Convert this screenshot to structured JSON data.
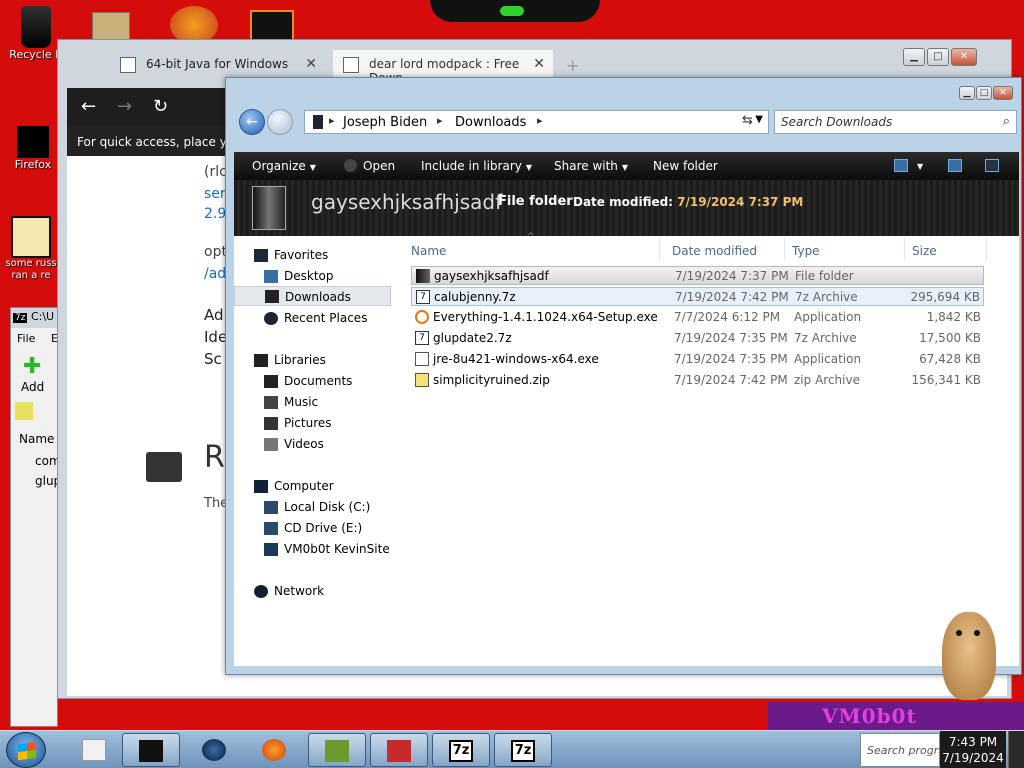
{
  "desktop": {
    "icons": [
      {
        "name": "recycle-bin",
        "label": "Recycle B"
      },
      {
        "name": "firefox",
        "label": "Firefox"
      },
      {
        "name": "russian",
        "label": "some russ ran a re"
      }
    ],
    "taskbar_logo_text": "VM0b0t"
  },
  "browser": {
    "tabs": [
      {
        "label": "64-bit Java for Windows",
        "close": "✕"
      },
      {
        "label": "dear lord modpack : Free Down",
        "close": "✕"
      }
    ],
    "new_tab": "+",
    "bookmarks_hint": "For quick access, place your",
    "page_text": {
      "t1": "(rlc",
      "t2": "ser",
      "t3": "2.9",
      "t4": "opt",
      "t5": "/ad",
      "t6": "Ad",
      "t7": "Ide",
      "t8": "Sc",
      "t9": "R",
      "t10": "The"
    }
  },
  "zip": {
    "title": "C:\\U",
    "menu_file": "File",
    "menu_e": "E",
    "add": "Add",
    "col_name": "Name",
    "row1": "com",
    "row2": "glup"
  },
  "explorer": {
    "address": {
      "crumb1": "Joseph Biden",
      "crumb2": "Downloads"
    },
    "search_placeholder": "Search Downloads",
    "toolbar": {
      "organize": "Organize",
      "open": "Open",
      "include": "Include in library",
      "share": "Share with",
      "new_folder": "New folder"
    },
    "preview": {
      "name": "gaysexhjksafhjsadf",
      "type": "File folder",
      "date_label": "Date modified:",
      "date_value": "7/19/2024 7:37 PM"
    },
    "nav": {
      "favorites": "Favorites",
      "desktop": "Desktop",
      "downloads": "Downloads",
      "recent": "Recent Places",
      "libraries": "Libraries",
      "documents": "Documents",
      "music": "Music",
      "pictures": "Pictures",
      "videos": "Videos",
      "computer": "Computer",
      "local_disk": "Local Disk (C:)",
      "cd_drive": "CD Drive (E:)",
      "vm": "VM0b0t KevinSite",
      "network": "Network"
    },
    "columns": {
      "name": "Name",
      "date": "Date modified",
      "type": "Type",
      "size": "Size"
    },
    "files": [
      {
        "name": "gaysexhjksafhjsadf",
        "date": "7/19/2024 7:37 PM",
        "type": "File folder",
        "size": ""
      },
      {
        "name": "calubjenny.7z",
        "date": "7/19/2024 7:42 PM",
        "type": "7z Archive",
        "size": "295,694 KB"
      },
      {
        "name": "Everything-1.4.1.1024.x64-Setup.exe",
        "date": "7/7/2024 6:12 PM",
        "type": "Application",
        "size": "1,842 KB"
      },
      {
        "name": "glupdate2.7z",
        "date": "7/19/2024 7:35 PM",
        "type": "7z Archive",
        "size": "17,500 KB"
      },
      {
        "name": "jre-8u421-windows-x64.exe",
        "date": "7/19/2024 7:35 PM",
        "type": "Application",
        "size": "67,428 KB"
      },
      {
        "name": "simplicityruined.zip",
        "date": "7/19/2024 7:42 PM",
        "type": "zip Archive",
        "size": "156,341 KB"
      }
    ]
  },
  "taskbar": {
    "search_placeholder": "Search progra",
    "time": "7:43 PM",
    "date": "7/19/2024",
    "z7_1": "7z",
    "z7_2": "7z"
  }
}
